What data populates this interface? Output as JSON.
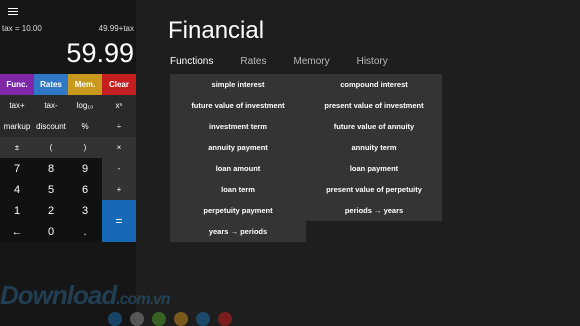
{
  "calc": {
    "tax_rate": "tax = 10.00",
    "tax_result": "49.99+tax",
    "display": "59.99",
    "rows": [
      [
        "Func.",
        "Rates",
        "Mem.",
        "Clear"
      ],
      [
        "tax+",
        "tax-",
        "log₁₀",
        "xⁿ"
      ],
      [
        "markup",
        "discount",
        "%",
        "÷"
      ],
      [
        "±",
        "(",
        ")",
        "×"
      ],
      [
        "7",
        "8",
        "9",
        "-"
      ],
      [
        "4",
        "5",
        "6",
        "+"
      ],
      [
        "1",
        "2",
        "3",
        ""
      ],
      [
        "←",
        "0",
        ".",
        ""
      ]
    ],
    "equals": "="
  },
  "panel": {
    "title": "Financial",
    "tabs": [
      "Functions",
      "Rates",
      "Memory",
      "History"
    ],
    "functions": [
      [
        "simple interest",
        "compound interest"
      ],
      [
        "future value of investment",
        "present value of investment"
      ],
      [
        "investment term",
        "future value of annuity"
      ],
      [
        "annuity payment",
        "annuity term"
      ],
      [
        "loan amount",
        "loan payment"
      ],
      [
        "loan term",
        "present value of perpetuity"
      ],
      [
        "perpetuity payment",
        "periods → years"
      ],
      [
        "years → periods",
        ""
      ]
    ]
  },
  "watermark": {
    "main": "Download",
    "suffix": ".com.vn"
  },
  "colors": {
    "func": "#7e28a8",
    "rates": "#2f78c8",
    "mem": "#c79a1e",
    "clear": "#c51e1e",
    "equals": "#1868b8",
    "dots": [
      "#1b6ea8",
      "#888888",
      "#4c9a2a",
      "#c78a1e",
      "#1b6ea8",
      "#c51e1e"
    ]
  }
}
